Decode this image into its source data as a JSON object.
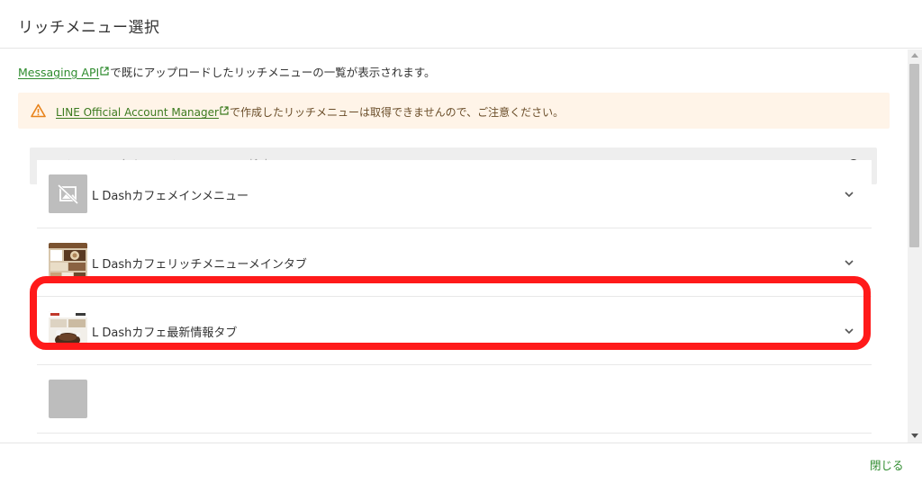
{
  "modal": {
    "title": "リッチメニュー選択",
    "info": {
      "link_text": "Messaging API",
      "text": "で既にアップロードしたリッチメニューの一覧が表示されます。"
    },
    "warning": {
      "link_text": "LINE Official Account Manager",
      "text": "で作成したリッチメニューは取得できませんので、ご注意ください。",
      "icon": "warning-triangle-icon",
      "color": "#e8821a"
    },
    "search": {
      "placeholder": "リッチメニュー名やリッチメニューIDで検索",
      "icon": "search-icon"
    },
    "items": [
      {
        "label": "L Dashカフェメインメニュー",
        "thumbnail": "no-image-icon"
      },
      {
        "label": "L Dashカフェリッチメニューメインタブ",
        "thumbnail": "cafe-menu-thumbnail",
        "highlighted": true
      },
      {
        "label": "L Dashカフェ最新情報タブ",
        "thumbnail": "cafe-news-thumbnail"
      },
      {
        "label": "",
        "thumbnail": "placeholder-thumbnail"
      }
    ],
    "footer": {
      "close_label": "閉じる"
    }
  },
  "colors": {
    "accent": "#2e8b2e",
    "highlight": "#ff1a1a",
    "warning_bg": "#fff4e8"
  }
}
